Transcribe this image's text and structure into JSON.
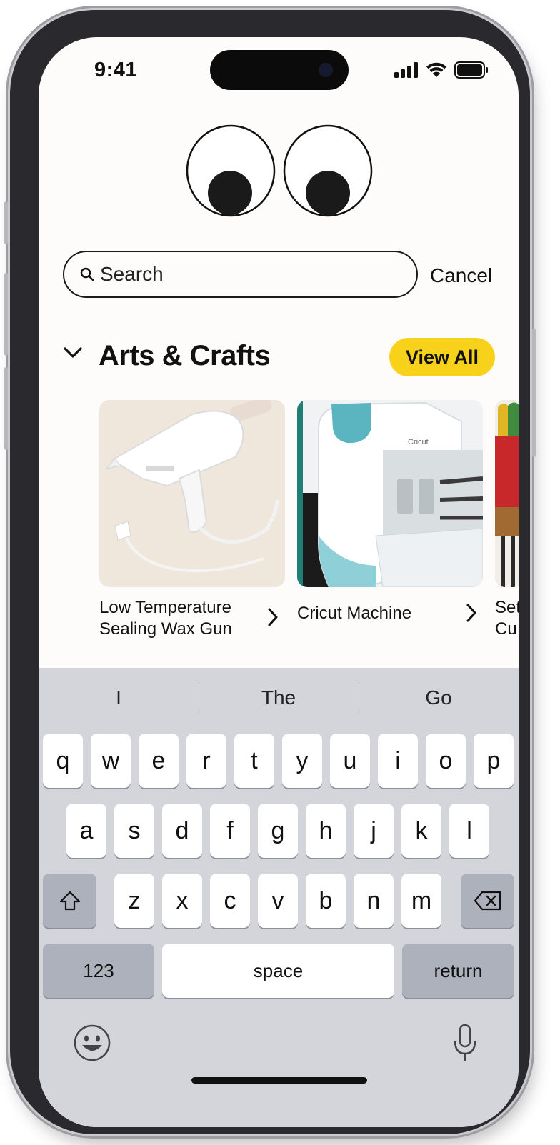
{
  "status_bar": {
    "time": "9:41",
    "icons": [
      "signal-icon",
      "wifi-icon",
      "battery-icon"
    ]
  },
  "logo": {
    "icon": "googly-eyes-logo"
  },
  "search": {
    "placeholder": "Search",
    "value": "",
    "cancel_label": "Cancel"
  },
  "section": {
    "title": "Arts & Crafts",
    "view_all_label": "View All",
    "accent": "#f8d21a",
    "cards": [
      {
        "title_line1": "Low Temperature",
        "title_line2": "Sealing Wax Gun",
        "image": "glue-gun-image"
      },
      {
        "title_line1": "Cricut Machine",
        "title_line2": "",
        "image": "cricut-machine-image"
      },
      {
        "title_line1": "Set",
        "title_line2": "Cu",
        "image": "scissors-set-image"
      }
    ]
  },
  "keyboard": {
    "suggestions": [
      "I",
      "The",
      "Go"
    ],
    "row1": [
      "q",
      "w",
      "e",
      "r",
      "t",
      "y",
      "u",
      "i",
      "o",
      "p"
    ],
    "row2": [
      "a",
      "s",
      "d",
      "f",
      "g",
      "h",
      "j",
      "k",
      "l"
    ],
    "row3": [
      "z",
      "x",
      "c",
      "v",
      "b",
      "n",
      "m"
    ],
    "numbers_label": "123",
    "space_label": "space",
    "return_label": "return"
  }
}
